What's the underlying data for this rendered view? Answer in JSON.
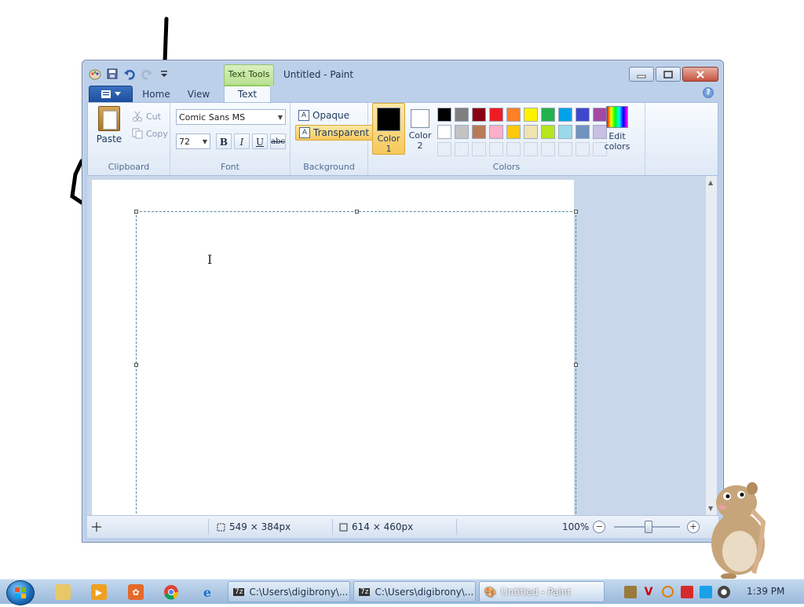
{
  "window": {
    "title": "Untitled - Paint",
    "contextual_tab": "Text Tools"
  },
  "tabs": {
    "home": "Home",
    "view": "View",
    "text": "Text",
    "active": "Text"
  },
  "clipboard": {
    "paste": "Paste",
    "cut": "Cut",
    "copy": "Copy",
    "group_label": "Clipboard"
  },
  "font": {
    "family": "Comic Sans MS",
    "size": "72",
    "bold": "B",
    "italic": "I",
    "underline": "U",
    "strikethrough": "abc",
    "group_label": "Font"
  },
  "background": {
    "opaque": "Opaque",
    "transparent": "Transparent",
    "selected": "Transparent",
    "group_label": "Background"
  },
  "colors": {
    "color1_label_line1": "Color",
    "color1_label_line2": "1",
    "color2_label_line1": "Color",
    "color2_label_line2": "2",
    "color1": "#000000",
    "color2": "#ffffff",
    "edit_colors_line1": "Edit",
    "edit_colors_line2": "colors",
    "group_label": "Colors",
    "palette_row1": [
      "#000000",
      "#7f7f7f",
      "#880015",
      "#ed1c24",
      "#ff7f27",
      "#fff200",
      "#22b14c",
      "#00a2e8",
      "#3f48cc",
      "#a349a4"
    ],
    "palette_row2": [
      "#ffffff",
      "#c3c3c3",
      "#b97a57",
      "#ffaec9",
      "#ffc90e",
      "#efe4b0",
      "#b5e61d",
      "#99d9ea",
      "#7092be",
      "#c8bfe7"
    ]
  },
  "status": {
    "selection_size": "549 × 384px",
    "image_size": "614 × 460px",
    "zoom": "100%"
  },
  "taskbar": {
    "task1": "C:\\Users\\digibrony\\...",
    "task2": "C:\\Users\\digibrony\\...",
    "task3": "Untitled - Paint",
    "clock": "1:39 PM"
  }
}
